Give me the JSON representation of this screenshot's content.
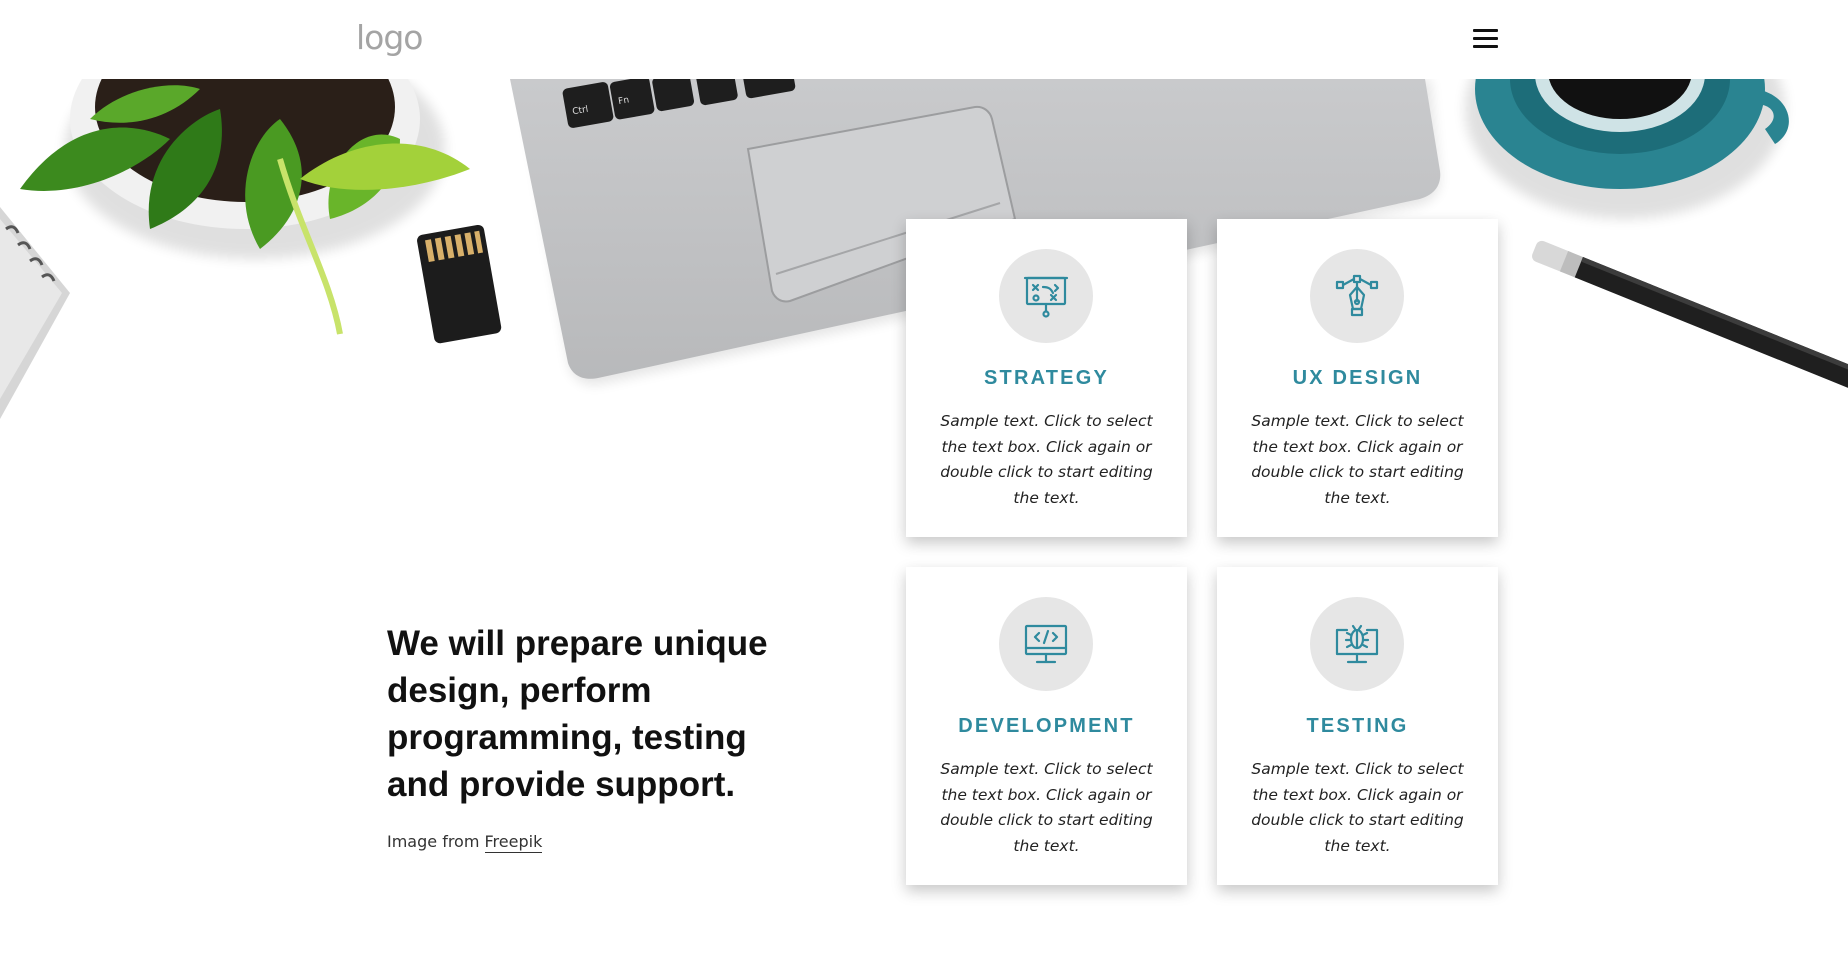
{
  "header": {
    "logo_text": "logo",
    "menu_icon": "hamburger-menu-icon"
  },
  "hero": {
    "headline": "We will prepare unique design, perform programming, testing and provide support.",
    "credit_prefix": "Image from ",
    "credit_link": "Freepik"
  },
  "cards": [
    {
      "title": "STRATEGY",
      "icon": "strategy-board-icon",
      "text": "Sample text. Click to select the text box. Click again or double click to start editing the text."
    },
    {
      "title": "UX DESIGN",
      "icon": "pen-tool-icon",
      "text": "Sample text. Click to select the text box. Click again or double click to start editing the text."
    },
    {
      "title": "DEVELOPMENT",
      "icon": "code-monitor-icon",
      "text": "Sample text. Click to select the text box. Click again or double click to start editing the text."
    },
    {
      "title": "TESTING",
      "icon": "bug-monitor-icon",
      "text": "Sample text. Click to select the text box. Click again or double click to start editing the text."
    }
  ],
  "colors": {
    "accent": "#2f8a9e",
    "icon_bg": "#e6e6e6",
    "heading": "#111111"
  }
}
